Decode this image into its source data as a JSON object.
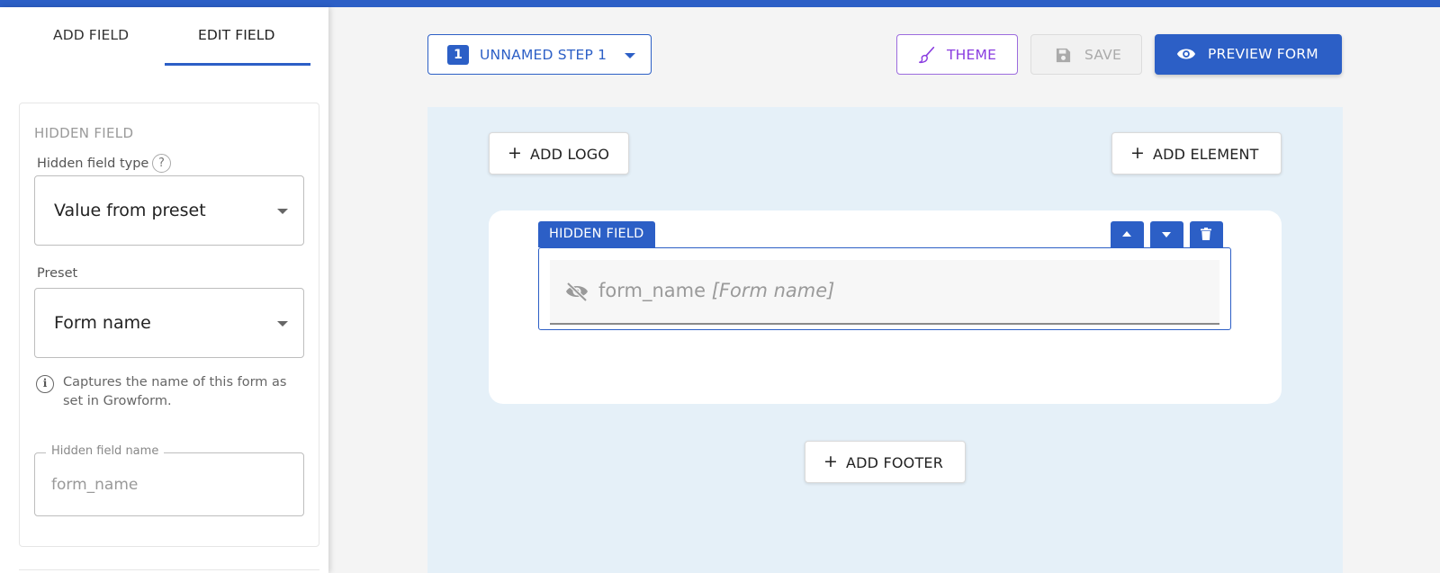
{
  "sidebar": {
    "tabs": [
      {
        "label": "ADD FIELD"
      },
      {
        "label": "EDIT FIELD"
      }
    ],
    "active_tab": "EDIT FIELD",
    "card_title": "HIDDEN FIELD",
    "type_label": "Hidden field type",
    "type_help": "?",
    "type_value": "Value from preset",
    "preset_label": "Preset",
    "preset_value": "Form name",
    "info_icon": "i",
    "info_text": "Captures the name of this form as set in Growform.",
    "name_legend": "Hidden field name",
    "name_placeholder": "form_name"
  },
  "toolbar": {
    "step_number": "1",
    "step_label": "UNNAMED STEP 1",
    "theme_label": "THEME",
    "save_label": "SAVE",
    "preview_label": "PREVIEW FORM"
  },
  "canvas": {
    "add_logo": "ADD LOGO",
    "add_element": "ADD ELEMENT",
    "add_footer": "ADD FOOTER",
    "plus": "+",
    "hidden_field_tag": "HIDDEN FIELD",
    "field_name": "form_name",
    "field_preset": "[Form name]"
  },
  "colors": {
    "primary": "#2c5fc6",
    "theme_purple": "#8a3de0",
    "canvas_bg": "#e5f0f8"
  }
}
